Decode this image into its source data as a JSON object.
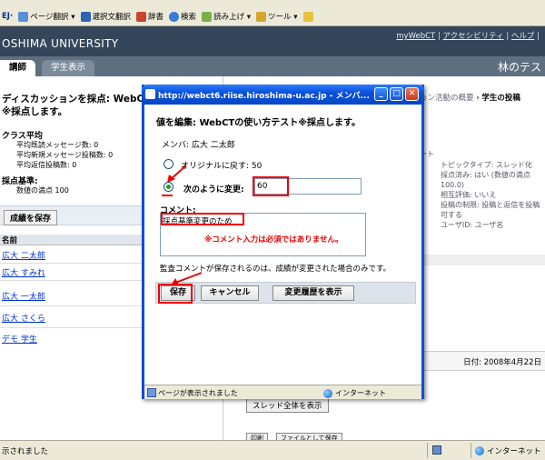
{
  "toolbar": {
    "row1": "08  EJ·",
    "items": [
      {
        "label": "ページ翻訳 ▾"
      },
      {
        "label": "選択文翻訳"
      },
      {
        "label": "辞書"
      },
      {
        "label": "検索"
      },
      {
        "label": "読み上げ ▾"
      },
      {
        "label": "ツール ▾"
      }
    ],
    "ej": "EJ·"
  },
  "header": {
    "university": "OSHIMA UNIVERSITY",
    "links": [
      "myWebCT",
      "アクセシビリティ",
      "ヘルプ"
    ],
    "tabs": [
      "講師",
      "学生表示"
    ],
    "course": "林のテス"
  },
  "left_page": {
    "title_line1": "ディスカッションを採点: WebCT",
    "title_line2": "※採点します。",
    "class_avg_label": "クラス平均",
    "class_avg": [
      "平均既読メッセージ数: 0",
      "平均新規メッセージ投稿数: 0",
      "平均返信投稿数: 0"
    ],
    "criteria_label": "採点基準:",
    "criteria_value": "数値の満点 100",
    "save_grades": "成績を保存",
    "name_header": "名前",
    "students": [
      "広大 二太郎",
      "広大 すみれ",
      "広大 一太郎",
      "広大 さくら",
      "デモ 学生"
    ]
  },
  "right_page": {
    "breadcrumb_gray": "ョン活動の概要",
    "breadcrumb_sep": "›",
    "breadcrumb_bold": "学生の投稿",
    "meta_prefix": "ート",
    "meta": [
      "トピックタイプ: スレッド化",
      "採点済み: はい (数値の満点",
      "100.0)",
      "相互評価: いいえ",
      "投稿の制限: 投稿と返信を投稿",
      "可する",
      "ユーザID: ユーザ名"
    ],
    "date": "日付: 2008年4月22日",
    "thread_button": "スレッド全体を表示",
    "bottom_buttons": [
      "印刷",
      "ファイルとして保存"
    ]
  },
  "popup": {
    "title": "http://webct6.riise.hiroshima-u.ac.jp - メンバ...",
    "heading": "値を編集: WebCTの使い方テスト※採点します。",
    "member": "メンバ: 広大 二太郎",
    "revert_label": "オリジナルに戻す: 50",
    "change_label": "次のように変更:",
    "score_value": "60",
    "comment_label": "コメント:",
    "comment_value": "採点基準変更のため",
    "note": "※コメント入力は必須ではありません。",
    "audit": "監査コメントが保存されるのは、成績が変更された場合のみです。",
    "buttons": {
      "save": "保存",
      "cancel": "キャンセル",
      "history": "変更履歴を表示"
    },
    "status_left": "ページが表示されました",
    "status_zone": "インターネット"
  },
  "status": {
    "left": "示されました",
    "zone": "インターネット"
  },
  "colors": {
    "header_bg": "#35465a",
    "tabbar_bg": "#5e6f80",
    "xp_blue": "#0a4fd6",
    "annotation_red": "#e00000",
    "note_red": "#e00000"
  }
}
